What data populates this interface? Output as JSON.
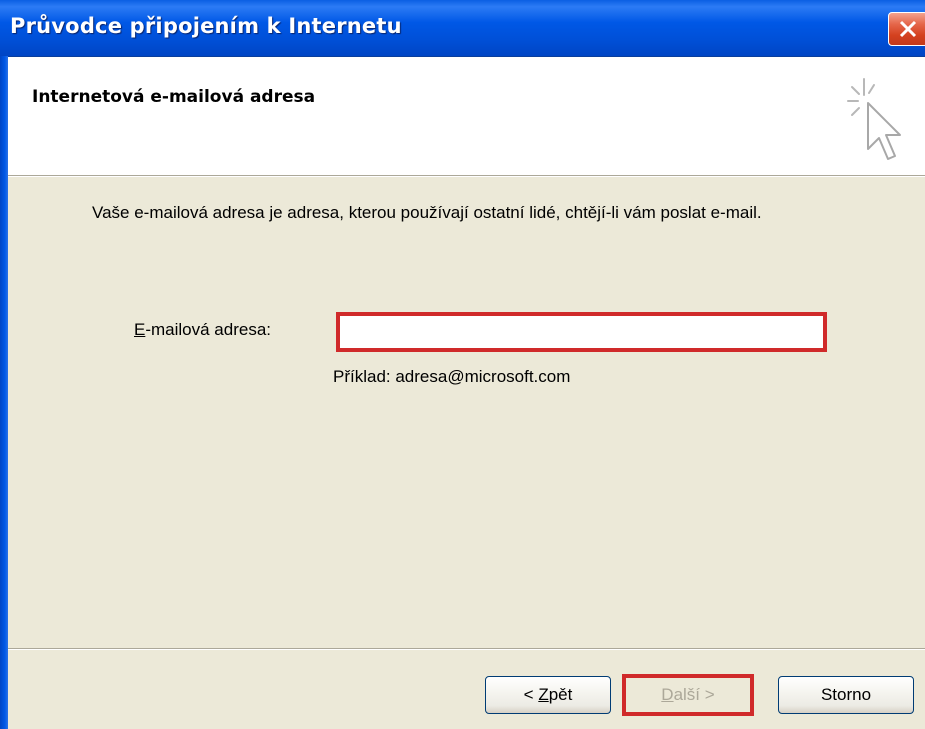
{
  "window": {
    "title": "Průvodce připojením k Internetu"
  },
  "header": {
    "title": "Internetová e-mailová adresa",
    "icon": "wizard-cursor-sparkle-icon"
  },
  "body": {
    "description": "Vaše e-mailová adresa je adresa, kterou používají ostatní lidé, chtějí-li vám poslat e-mail.",
    "email": {
      "label_mnemonic": "E",
      "label_rest": "-mailová adresa:",
      "value": "",
      "example": "Příklad: adresa@microsoft.com"
    }
  },
  "buttons": {
    "back": {
      "prefix": "< ",
      "mnemonic": "Z",
      "rest": "pět"
    },
    "next": {
      "mnemonic": "D",
      "rest": "alší >",
      "enabled": false
    },
    "cancel": {
      "label": "Storno"
    }
  },
  "colors": {
    "titlebar": "#0058e6",
    "dialog_bg": "#ece9d8",
    "highlight": "#d02a2a",
    "close_button": "#d4411f"
  }
}
